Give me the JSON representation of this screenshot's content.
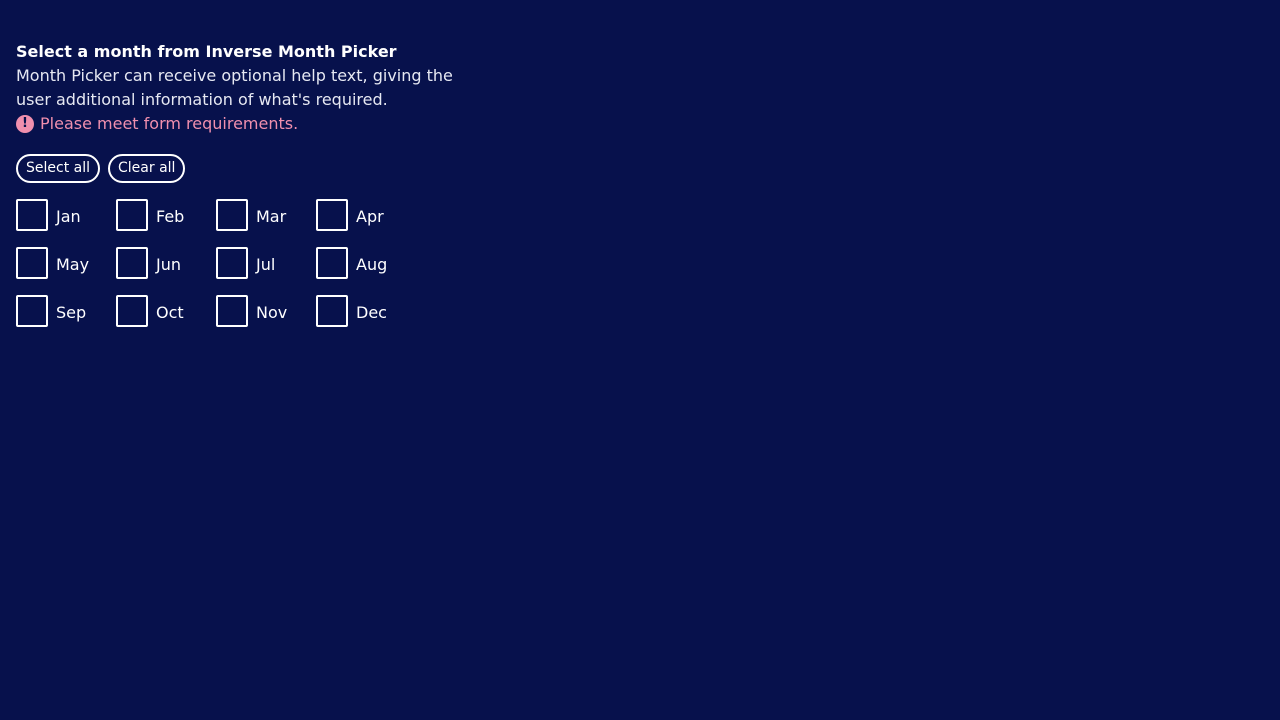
{
  "picker": {
    "label": "Select a month from Inverse Month Picker",
    "help_text": "Month Picker can receive optional help text, giving the user additional information of what's required.",
    "error_text": "Please meet form requirements.",
    "error_icon": "exclamation-circle-icon",
    "select_all_label": "Select all",
    "clear_all_label": "Clear all",
    "months": [
      {
        "label": "Jan",
        "checked": false
      },
      {
        "label": "Feb",
        "checked": false
      },
      {
        "label": "Mar",
        "checked": false
      },
      {
        "label": "Apr",
        "checked": false
      },
      {
        "label": "May",
        "checked": false
      },
      {
        "label": "Jun",
        "checked": false
      },
      {
        "label": "Jul",
        "checked": false
      },
      {
        "label": "Aug",
        "checked": false
      },
      {
        "label": "Sep",
        "checked": false
      },
      {
        "label": "Oct",
        "checked": false
      },
      {
        "label": "Nov",
        "checked": false
      },
      {
        "label": "Dec",
        "checked": false
      }
    ]
  },
  "colors": {
    "background": "#07114c",
    "text": "#ffffff",
    "error": "#f08fae"
  }
}
